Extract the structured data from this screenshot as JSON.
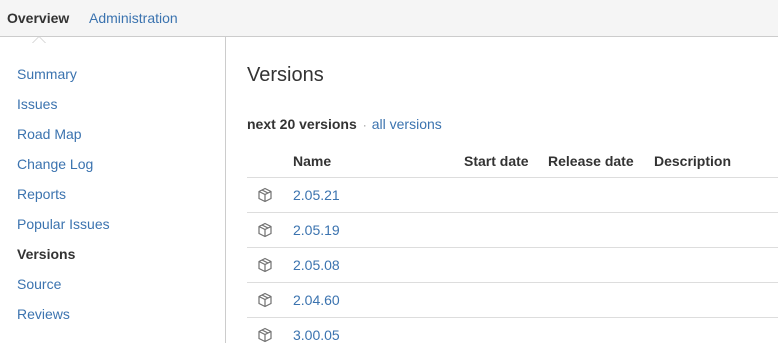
{
  "nav_tabs": {
    "overview": "Overview",
    "administration": "Administration"
  },
  "sidebar": {
    "items": [
      {
        "label": "Summary",
        "active": false
      },
      {
        "label": "Issues",
        "active": false
      },
      {
        "label": "Road Map",
        "active": false
      },
      {
        "label": "Change Log",
        "active": false
      },
      {
        "label": "Reports",
        "active": false
      },
      {
        "label": "Popular Issues",
        "active": false
      },
      {
        "label": "Versions",
        "active": true
      },
      {
        "label": "Source",
        "active": false
      },
      {
        "label": "Reviews",
        "active": false
      }
    ]
  },
  "main": {
    "title": "Versions",
    "filter": {
      "current": "next 20 versions",
      "separator": "·",
      "link": "all versions"
    },
    "table": {
      "columns": [
        "Name",
        "Start date",
        "Release date",
        "Description"
      ],
      "rows": [
        {
          "name": "2.05.21",
          "icon": "version-package-icon"
        },
        {
          "name": "2.05.19",
          "icon": "version-package-icon"
        },
        {
          "name": "2.05.08",
          "icon": "version-package-icon"
        },
        {
          "name": "2.04.60",
          "icon": "version-package-icon"
        },
        {
          "name": "3.00.05",
          "icon": "version-package-icon"
        }
      ]
    }
  },
  "colors": {
    "link": "#3b73af",
    "text": "#333333",
    "topbar": "#f5f5f5",
    "border": "#cccccc"
  }
}
